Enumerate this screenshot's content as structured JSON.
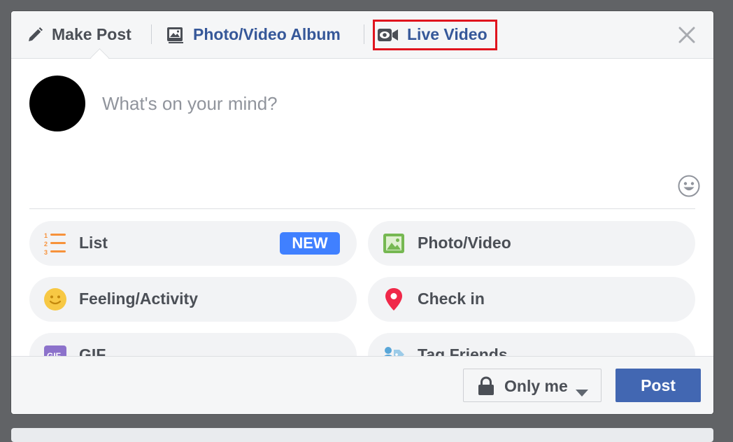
{
  "tabs": [
    {
      "label": "Make Post",
      "icon": "pencil-icon"
    },
    {
      "label": "Photo/Video Album",
      "icon": "photo-album-icon"
    },
    {
      "label": "Live Video",
      "icon": "video-camera-icon"
    }
  ],
  "composer": {
    "placeholder": "What's on your mind?"
  },
  "options": [
    {
      "label": "List",
      "icon": "numbered-list-icon",
      "badge": "NEW"
    },
    {
      "label": "Photo/Video",
      "icon": "photo-icon"
    },
    {
      "label": "Feeling/Activity",
      "icon": "smiley-icon"
    },
    {
      "label": "Check in",
      "icon": "location-pin-icon"
    },
    {
      "label": "GIF",
      "icon": "gif-icon"
    },
    {
      "label": "Tag Friends",
      "icon": "tag-friends-icon"
    }
  ],
  "footer": {
    "privacy_label": "Only me",
    "post_label": "Post"
  },
  "colors": {
    "link_blue": "#365899",
    "post_button": "#4267b2",
    "badge_blue": "#4080ff",
    "highlight_red": "#e0141e"
  }
}
